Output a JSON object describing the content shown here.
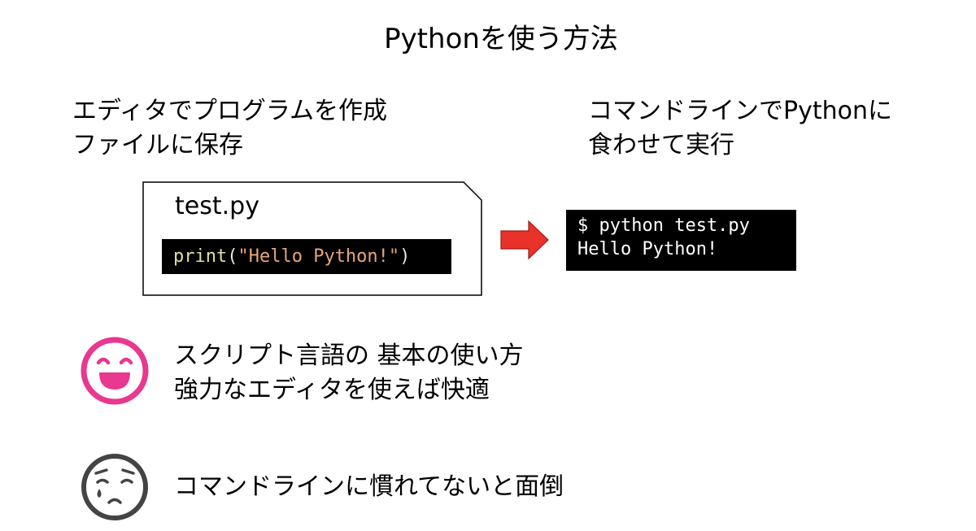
{
  "title": "Pythonを使う方法",
  "left": {
    "line1": "エディタでプログラムを作成",
    "line2": "ファイルに保存",
    "file_name": "test.py",
    "code": {
      "func": "print",
      "open": "(",
      "string": "\"Hello Python!\"",
      "close": ")"
    }
  },
  "right": {
    "line1": "コマンドラインでPythonに",
    "line2": "食わせて実行",
    "terminal": {
      "command": "$ python test.py",
      "output": "Hello Python!"
    }
  },
  "pros": {
    "icon": "smiling-face-icon",
    "line1": "スクリプト言語の 基本の使い方",
    "line2": "強力なエディタを使えば快適"
  },
  "cons": {
    "icon": "worried-face-icon",
    "line1": "コマンドラインに慣れてないと面倒"
  },
  "colors": {
    "arrow": "#e8322a",
    "smile_icon": "#e8388f",
    "worried_icon": "#444444",
    "code_function": "#dfe0a0",
    "code_string": "#e8a57a"
  }
}
